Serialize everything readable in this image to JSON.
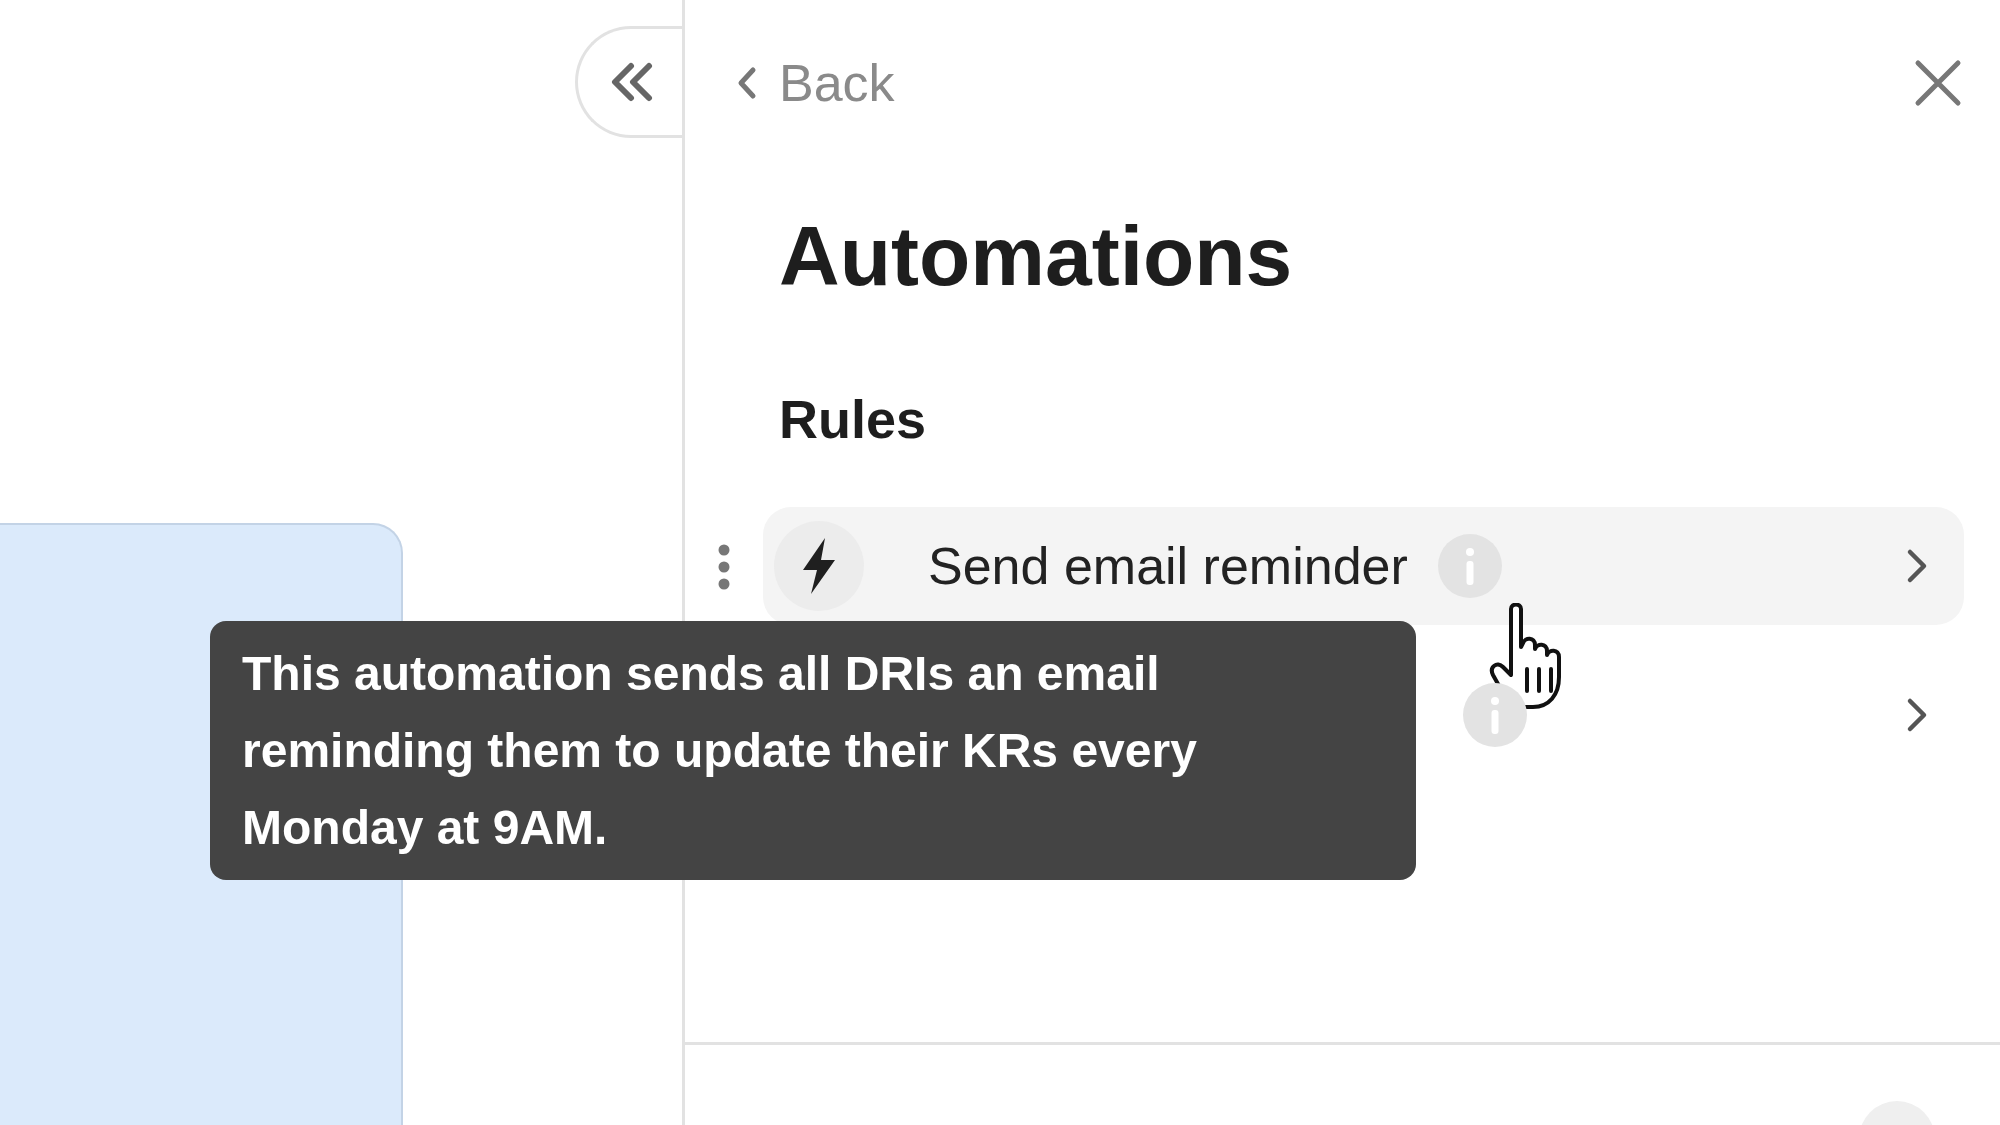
{
  "panel": {
    "back_label": "Back",
    "title": "Automations",
    "section_title": "Rules"
  },
  "rules": [
    {
      "title": "Send email reminder",
      "hovered": true
    },
    {
      "hovered": false
    }
  ],
  "tooltip": {
    "text": "This automation sends all DRIs an email reminding them to update their KRs every Monday at 9AM."
  }
}
